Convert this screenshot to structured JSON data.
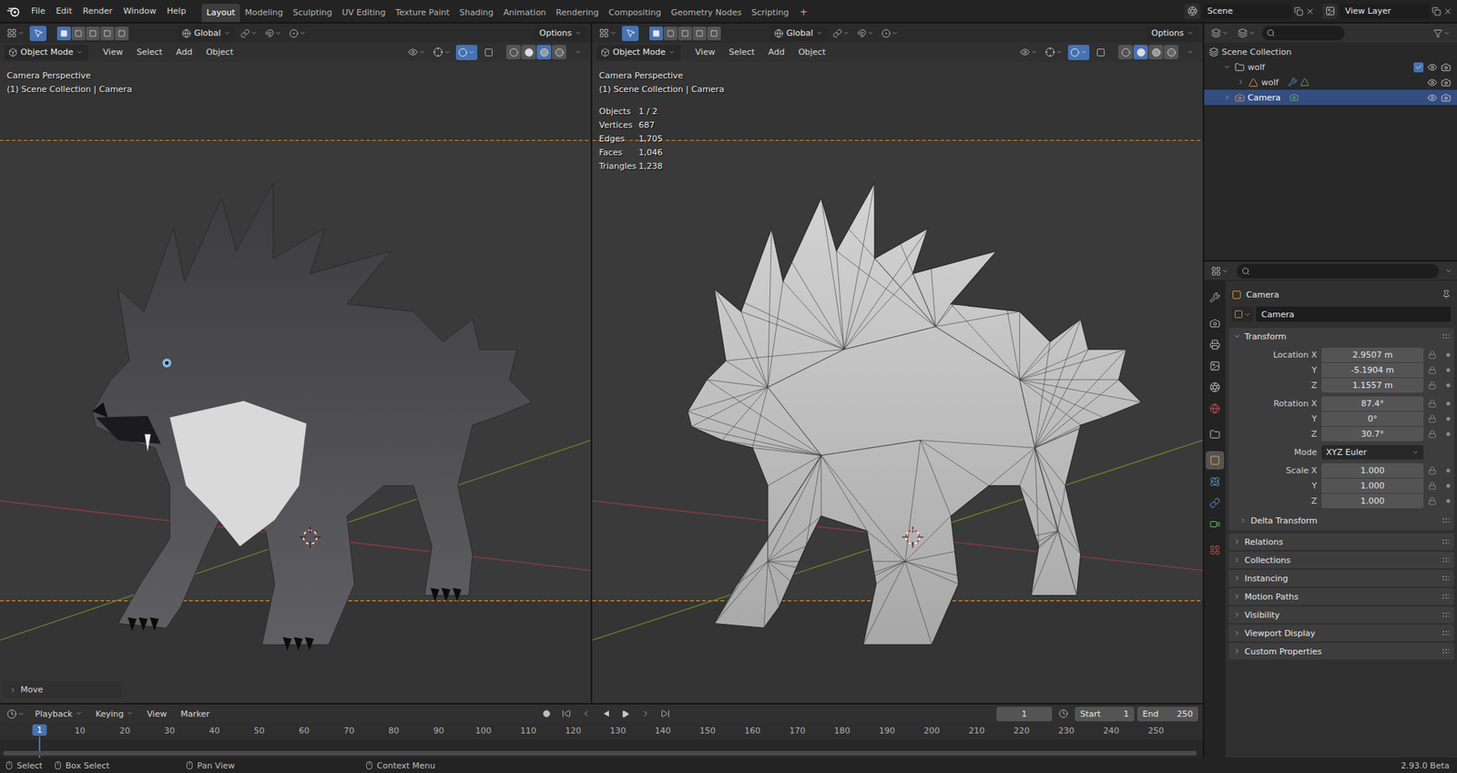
{
  "topbar": {
    "menus": [
      "File",
      "Edit",
      "Render",
      "Window",
      "Help"
    ],
    "workspaces": [
      {
        "label": "Layout",
        "selected": true
      },
      {
        "label": "Modeling",
        "selected": false
      },
      {
        "label": "Sculpting",
        "selected": false
      },
      {
        "label": "UV Editing",
        "selected": false
      },
      {
        "label": "Texture Paint",
        "selected": false
      },
      {
        "label": "Shading",
        "selected": false
      },
      {
        "label": "Animation",
        "selected": false
      },
      {
        "label": "Rendering",
        "selected": false
      },
      {
        "label": "Compositing",
        "selected": false
      },
      {
        "label": "Geometry Nodes",
        "selected": false
      },
      {
        "label": "Scripting",
        "selected": false
      }
    ],
    "add_workspace": "+",
    "scene": "Scene",
    "view_layer": "View Layer"
  },
  "viewports": [
    {
      "kind": "material",
      "orientation": "Global",
      "options": "Options",
      "select_modes": [
        {
          "selected": true
        },
        {
          "selected": false
        },
        {
          "selected": false
        },
        {
          "selected": false
        },
        {
          "selected": false
        }
      ],
      "mode": "Object Mode",
      "menus": [
        "View",
        "Select",
        "Add",
        "Object"
      ],
      "overlays_on": true,
      "shading": [
        {
          "selected": false
        },
        {
          "selected": false
        },
        {
          "selected": true
        },
        {
          "selected": false
        }
      ],
      "overlay_lines": [
        "Camera Perspective",
        "(1) Scene Collection | Camera"
      ],
      "stats": [],
      "operator": "Move"
    },
    {
      "kind": "wireframe",
      "orientation": "Global",
      "options": "Options",
      "select_modes": [
        {
          "selected": true
        },
        {
          "selected": false
        },
        {
          "selected": false
        },
        {
          "selected": false
        },
        {
          "selected": false
        }
      ],
      "mode": "Object Mode",
      "menus": [
        "View",
        "Select",
        "Add",
        "Object"
      ],
      "overlays_on": true,
      "shading": [
        {
          "selected": false
        },
        {
          "selected": true
        },
        {
          "selected": false
        },
        {
          "selected": false
        }
      ],
      "overlay_lines": [
        "Camera Perspective",
        "(1) Scene Collection | Camera"
      ],
      "stats": [
        {
          "label": "Objects",
          "value": "1 / 2"
        },
        {
          "label": "Vertices",
          "value": "687"
        },
        {
          "label": "Edges",
          "value": "1,705"
        },
        {
          "label": "Faces",
          "value": "1,046"
        },
        {
          "label": "Triangles",
          "value": "1,238"
        }
      ]
    }
  ],
  "outliner": {
    "items": [
      {
        "label": "Scene Collection",
        "kind": "scene_collection",
        "expandable": false,
        "expanded": true,
        "selected": false,
        "children": [
          {
            "label": "wolf",
            "kind": "collection",
            "expandable": true,
            "expanded": true,
            "selected": false,
            "checked": true,
            "visible": true,
            "renderable": true,
            "children": [
              {
                "label": "wolf",
                "kind": "mesh",
                "expandable": true,
                "expanded": false,
                "selected": false,
                "visible": true,
                "renderable": true,
                "children": []
              }
            ]
          },
          {
            "label": "Camera",
            "kind": "camera",
            "expandable": true,
            "expanded": false,
            "selected": true,
            "visible": true,
            "renderable": true,
            "children": []
          }
        ]
      }
    ]
  },
  "properties": {
    "tabs": [
      {
        "selected": false
      },
      {
        "selected": false
      },
      {
        "selected": false
      },
      {
        "selected": false
      },
      {
        "selected": false
      },
      {
        "selected": false
      },
      {
        "selected": false
      },
      {
        "selected": true
      },
      {
        "selected": false
      },
      {
        "selected": false
      },
      {
        "selected": false
      },
      {
        "selected": false
      }
    ],
    "object_name": "Camera",
    "datablock": "Camera",
    "transform": {
      "title": "Transform",
      "expanded": true,
      "groups": [
        {
          "rows": [
            {
              "kind": "number",
              "label": "Location X",
              "value": "2.9507 m"
            },
            {
              "kind": "number",
              "label": "Y",
              "value": "-5.1904 m"
            },
            {
              "kind": "number",
              "label": "Z",
              "value": "1.1557 m"
            }
          ]
        },
        {
          "rows": [
            {
              "kind": "number",
              "label": "Rotation X",
              "value": "87.4°"
            },
            {
              "kind": "number",
              "label": "Y",
              "value": "0°"
            },
            {
              "kind": "number",
              "label": "Z",
              "value": "30.7°"
            }
          ]
        },
        {
          "rows": [
            {
              "kind": "enum",
              "label": "Mode",
              "value": "XYZ Euler"
            }
          ]
        },
        {
          "rows": [
            {
              "kind": "number",
              "label": "Scale X",
              "value": "1.000"
            },
            {
              "kind": "number",
              "label": "Y",
              "value": "1.000"
            },
            {
              "kind": "number",
              "label": "Z",
              "value": "1.000"
            }
          ]
        }
      ],
      "subpanel": {
        "title": "Delta Transform",
        "expanded": false
      }
    },
    "panels": [
      {
        "title": "Relations",
        "expanded": false
      },
      {
        "title": "Collections",
        "expanded": false
      },
      {
        "title": "Instancing",
        "expanded": false
      },
      {
        "title": "Motion Paths",
        "expanded": false
      },
      {
        "title": "Visibility",
        "expanded": false
      },
      {
        "title": "Viewport Display",
        "expanded": false
      },
      {
        "title": "Custom Properties",
        "expanded": false
      }
    ]
  },
  "timeline": {
    "menus": [
      {
        "label": "Playback",
        "dropdown": true
      },
      {
        "label": "Keying",
        "dropdown": true
      },
      {
        "label": "View",
        "dropdown": false
      },
      {
        "label": "Marker",
        "dropdown": false
      }
    ],
    "frame": "1",
    "start_label": "Start",
    "start": "1",
    "end_label": "End",
    "end": "250",
    "current": "1",
    "ticks": [
      "10",
      "20",
      "30",
      "40",
      "50",
      "60",
      "70",
      "80",
      "90",
      "100",
      "110",
      "120",
      "130",
      "140",
      "150",
      "160",
      "170",
      "180",
      "190",
      "200",
      "210",
      "220",
      "230",
      "240",
      "250"
    ]
  },
  "statusbar": {
    "hints": [
      "Select",
      "Box Select",
      "Pan View",
      "Context Menu"
    ],
    "version": "2.93.0 Beta"
  }
}
